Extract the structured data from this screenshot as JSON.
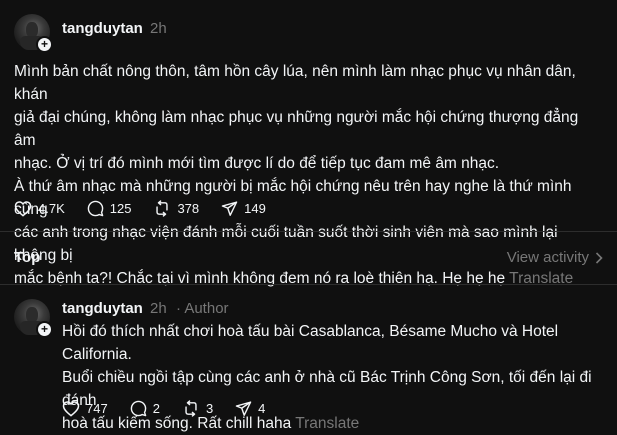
{
  "post": {
    "username": "tangduytan",
    "time": "2h",
    "text": "Mình bản chất nông thôn, tâm hồn cây lúa, nên mình làm nhạc phục vụ nhân dân, khán\ngiả đại chúng, không làm nhạc phục vụ những người mắc hội chứng thượng đẳng âm\nnhạc. Ở vị trí đó mình mới tìm được lí do để tiếp tục đam mê âm nhạc.\nÀ thứ âm nhạc mà những người bị mắc hội chứng nêu trên hay nghe là thứ mình cùng\ncác anh trong nhạc viện đánh mỗi cuối tuần suốt thời sinh viên mà sao mình lại không bị\nmắc bệnh ta?! Chắc tại vì mình không đem nó ra loè thiên hạ. Hẹ hẹ hẹ",
    "translate": "Translate",
    "likes": "4.7K",
    "comments": "125",
    "reposts": "378",
    "shares": "149"
  },
  "sort": {
    "label": "Top",
    "view_activity": "View activity"
  },
  "reply": {
    "username": "tangduytan",
    "time": "2h",
    "author_label": "· Author",
    "text": "Hồi đó thích nhất chơi hoà tấu bài Casablanca, Bésame Mucho và Hotel California.\nBuổi chiều ngồi tập cùng các anh ở nhà cũ Bác Trịnh Công Sơn, tối đến lại đi đánh\nhoà tấu kiếm sống. Rất chill haha",
    "translate": "Translate",
    "likes": "747",
    "comments": "2",
    "reposts": "3",
    "shares": "4"
  },
  "colors": {
    "background": "#101010",
    "text": "#f3f5f7",
    "muted": "#777777",
    "divider": "#2d2d2d"
  }
}
